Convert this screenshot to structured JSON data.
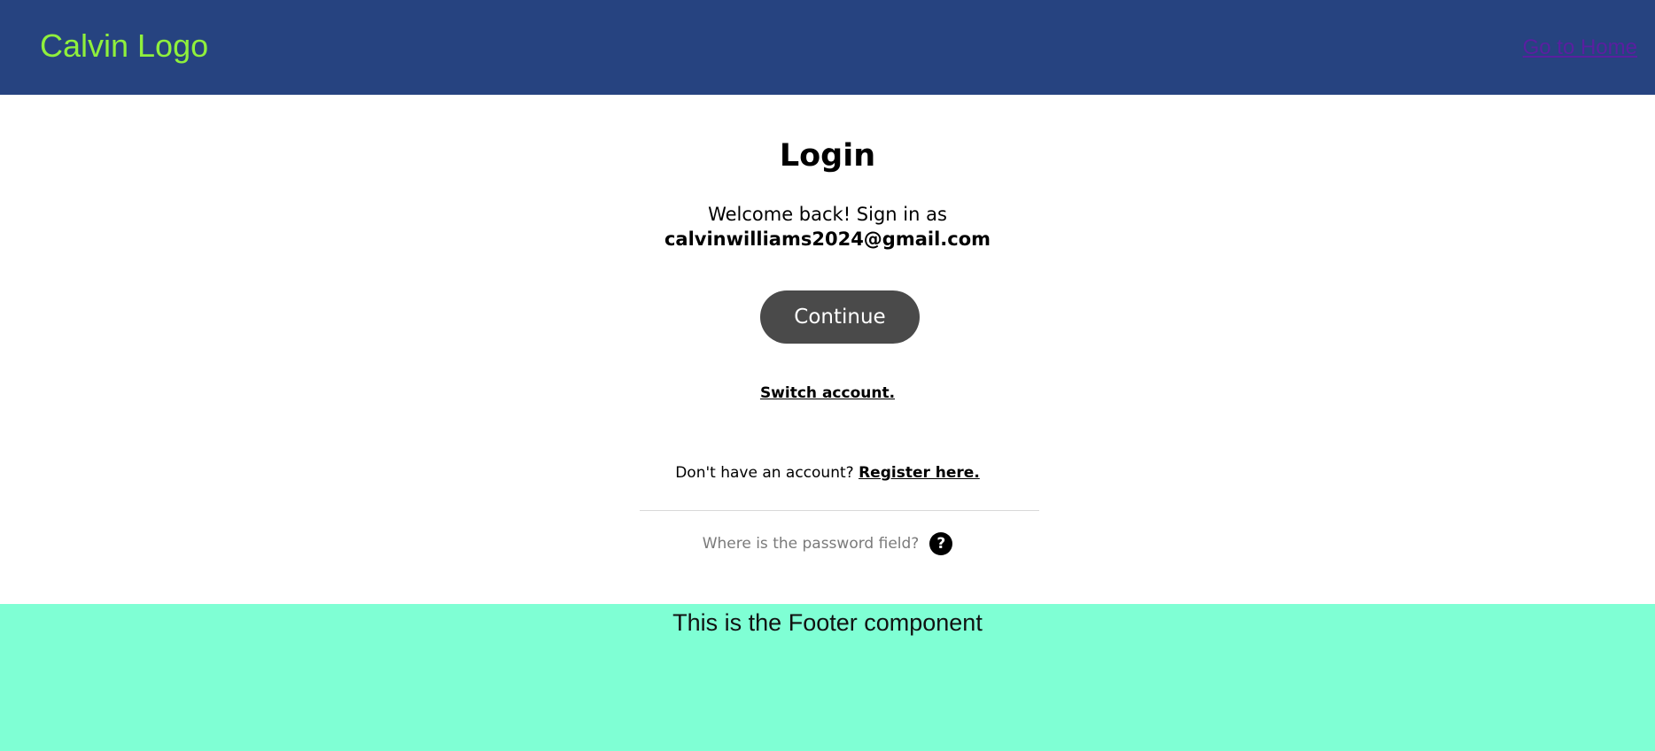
{
  "header": {
    "logo_text": "Calvin Logo",
    "home_link": "Go to Home",
    "background": "#264380",
    "logo_color": "#8ff03c"
  },
  "login": {
    "title": "Login",
    "welcome_text": "Welcome back! Sign in as",
    "email": "calvinwilliams2024@gmail.com",
    "continue_label": "Continue",
    "switch_account": "Switch account.",
    "register_prompt": "Don't have an account?",
    "register_link": "Register here.",
    "help_text": "Where is the password field?",
    "help_icon": "question-icon",
    "help_icon_glyph": "?"
  },
  "footer": {
    "text": "This is the Footer component",
    "background": "#7fffd4"
  }
}
